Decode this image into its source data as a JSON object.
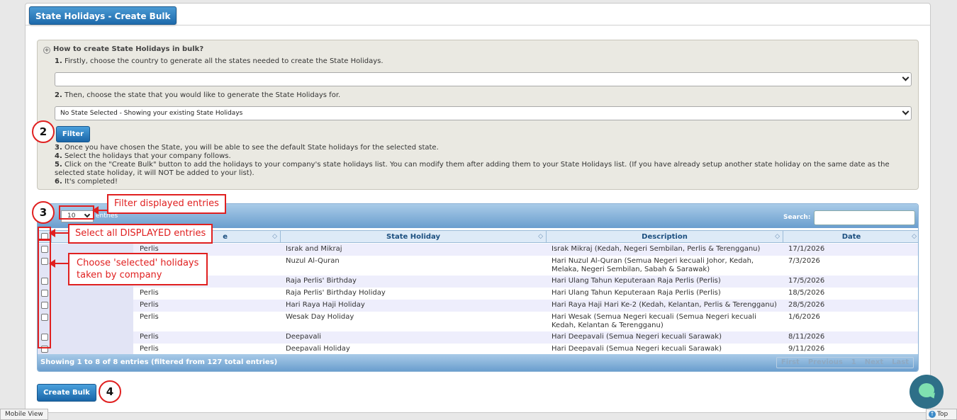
{
  "panel": {
    "title": "State Holidays - Create Bulk"
  },
  "howto": {
    "title": "How to create State Holidays in bulk?",
    "step1_num": "1.",
    "step1_text": "Firstly, choose the country to generate all the states needed to create the State Holidays.",
    "country_select_value": "",
    "step2_num": "2.",
    "step2_text": "Then, choose the state that you would like to generate the State Holidays for.",
    "state_select_value": "No State Selected - Showing your existing State Holidays",
    "filter_label": "Filter",
    "step3_num": "3.",
    "step3_text": "Once you have chosen the State, you will be able to see the default State holidays for the selected state.",
    "step4_num": "4.",
    "step4_text": "Select the holidays that your company follows.",
    "step5_num": "5.",
    "step5_text": "Click on the \"Create Bulk\" button to add the holidays to your company's state holidays list. You can modify them after adding them to your State Holidays list. (If you have already setup another state holiday on the same date as the selected state holiday, it will NOT be added to your list).",
    "step6_num": "6.",
    "step6_text": "It's completed!"
  },
  "table": {
    "length_value": "10",
    "length_suffix": "entries",
    "search_label": "Search:",
    "columns": [
      "e",
      "State Holiday",
      "Description",
      "Date"
    ],
    "rows": [
      {
        "state": "Perlis",
        "holiday": "Israk and Mikraj",
        "description": "Israk Mikraj (Kedah, Negeri Sembilan, Perlis & Terengganu)",
        "date": "17/1/2026"
      },
      {
        "state": "",
        "holiday": "Nuzul Al-Quran",
        "description": "Hari Nuzul Al-Quran (Semua Negeri kecuali Johor, Kedah, Melaka, Negeri Sembilan, Sabah & Sarawak)",
        "date": "7/3/2026"
      },
      {
        "state": "",
        "holiday": "Raja Perlis' Birthday",
        "description": "Hari Ulang Tahun Keputeraan Raja Perlis (Perlis)",
        "date": "17/5/2026"
      },
      {
        "state": "Perlis",
        "holiday": "Raja Perlis' Birthday Holiday",
        "description": "Hari Ulang Tahun Keputeraan Raja Perlis (Perlis)",
        "date": "18/5/2026"
      },
      {
        "state": "Perlis",
        "holiday": "Hari Raya Haji Holiday",
        "description": "Hari Raya Haji Hari Ke-2 (Kedah, Kelantan, Perlis & Terengganu)",
        "date": "28/5/2026"
      },
      {
        "state": "Perlis",
        "holiday": "Wesak Day Holiday",
        "description": "Hari Wesak (Semua Negeri kecuali (Semua Negeri kecuali Kedah, Kelantan & Terengganu)",
        "date": "1/6/2026"
      },
      {
        "state": "Perlis",
        "holiday": "Deepavali",
        "description": "Hari Deepavali (Semua Negeri kecuali Sarawak)",
        "date": "8/11/2026"
      },
      {
        "state": "Perlis",
        "holiday": "Deepavali Holiday",
        "description": "Hari Deepavali (Semua Negeri kecuali Sarawak)",
        "date": "9/11/2026"
      }
    ],
    "info": "Showing 1 to 8 of 8 entries (filtered from 127 total entries)",
    "pager": [
      "First",
      "Previous",
      "1",
      "Next",
      "Last"
    ]
  },
  "create_bulk_label": "Create Bulk",
  "annotations": {
    "step2": "2",
    "step3": "3",
    "step4": "4",
    "filter_callout": "Filter displayed entries",
    "select_all_callout": "Select all DISPLAYED entries",
    "choose_callout": "Choose 'selected' holidays taken by company"
  },
  "footer": {
    "mobile_view": "Mobile View",
    "top": "Top"
  }
}
